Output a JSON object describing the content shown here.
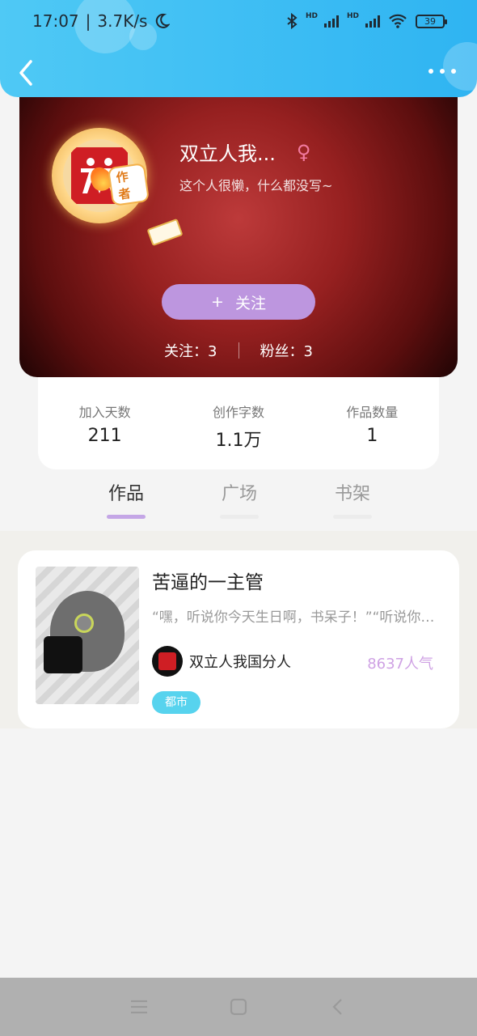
{
  "status_bar": {
    "time": "17:07",
    "speed": "3.7K/s",
    "hd1": "HD",
    "hd2": "HD",
    "battery": "39"
  },
  "profile": {
    "author_badge": "作者",
    "name": "双立人我...",
    "gender_symbol": "♀",
    "bio": "这个人很懒，什么都没写~",
    "follow_plus": "+",
    "follow_label": "关注",
    "following": "关注：3",
    "followers": "粉丝：3"
  },
  "stats": [
    {
      "label": "加入天数",
      "value": "211"
    },
    {
      "label": "创作字数",
      "value": "1.1万"
    },
    {
      "label": "作品数量",
      "value": "1"
    }
  ],
  "tabs": [
    {
      "label": "作品",
      "active": true
    },
    {
      "label": "广场",
      "active": false
    },
    {
      "label": "书架",
      "active": false
    }
  ],
  "works": [
    {
      "title": "苦逼的一主管",
      "excerpt": "“嘿，听说你今天生日啊，书呆子！”“听说你今天生日啊",
      "author": "双立人我国分人",
      "popularity": "8637人气",
      "tag": "都市"
    }
  ],
  "colors": {
    "header": "#2fb4f2",
    "follow_button": "#bd96df",
    "tab_indicator": "#c4a6e6",
    "tag": "#57d3ee",
    "popularity": "#cfa2e4"
  }
}
